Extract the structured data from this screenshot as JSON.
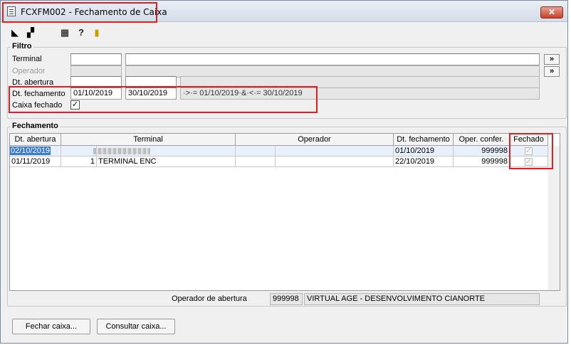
{
  "window": {
    "title": "FCXFM002 - Fechamento de Caixa",
    "close_label": "✕"
  },
  "toolbar": {
    "icons": [
      "first-record-icon",
      "copy-icon",
      "calculator-icon",
      "help-icon",
      "exit-door-icon"
    ]
  },
  "filtro": {
    "title": "Filtro",
    "terminal_label": "Terminal",
    "terminal_code": "",
    "terminal_name": "",
    "operador_label": "Operador",
    "abertura_label": "Dt. abertura",
    "fechamento_label": "Dt. fechamento",
    "fechamento_from": "01/10/2019",
    "fechamento_to": "30/10/2019",
    "fechamento_expr": "·>·= 01/10/2019·&·<·= 30/10/2019",
    "caixa_fechado_label": "Caixa fechado",
    "caixa_fechado_checked": true,
    "lookup_btn": "»"
  },
  "fechamento": {
    "title": "Fechamento",
    "columns": [
      "Dt. abertura",
      "Terminal",
      "Operador",
      "Dt. fechamento",
      "Oper. confer.",
      "Fechado"
    ],
    "rows": [
      {
        "abertura": "02/10/2019",
        "terminal_code": "",
        "terminal_name": "",
        "operador_code": "",
        "operador_name": "",
        "fechamento": "01/10/2019",
        "oper_confer": "999998",
        "fechado": true
      },
      {
        "abertura": "01/11/2019",
        "terminal_code": "1",
        "terminal_name": "TERMINAL ENC",
        "operador_code": "",
        "operador_name": "",
        "fechamento": "22/10/2019",
        "oper_confer": "999998",
        "fechado": true
      }
    ],
    "operador_abertura_label": "Operador de abertura",
    "operador_abertura_code": "999998",
    "operador_abertura_name": "VIRTUAL AGE - DESENVOLVIMENTO CIANORTE"
  },
  "buttons": {
    "fechar": "Fechar caixa...",
    "consultar": "Consultar caixa..."
  }
}
